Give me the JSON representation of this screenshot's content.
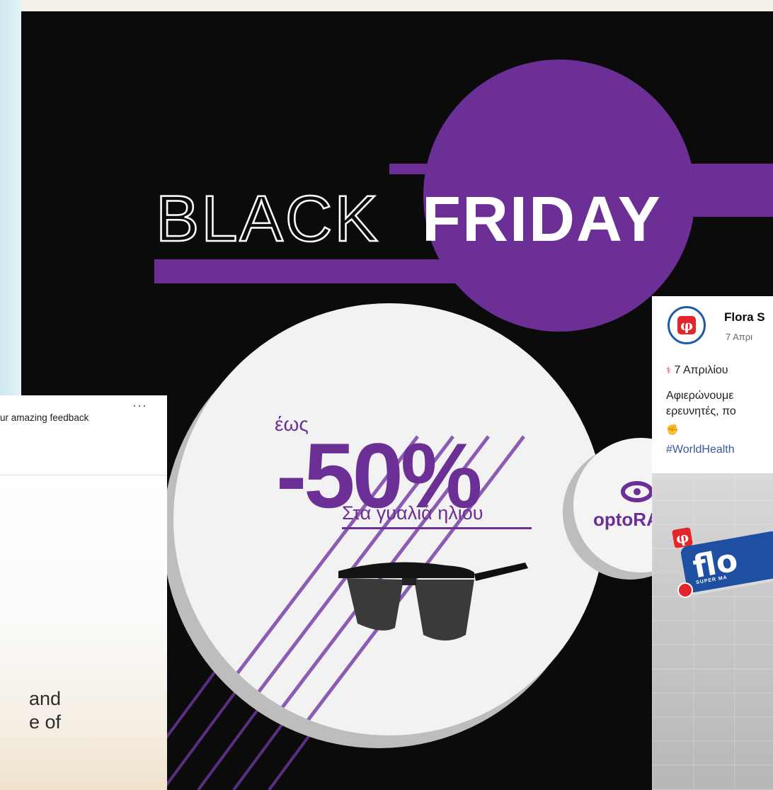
{
  "promo": {
    "title_outline": "BLACK",
    "title_solid": "FRIDAY",
    "prefix": "έως",
    "discount": "-50%",
    "subtitle": "Στα γυαλιά ηλίου",
    "brand": "optoRAMA",
    "colors": {
      "purple": "#6b2f96",
      "background": "#0b0b0b",
      "disc": "#f2f2f2"
    }
  },
  "left_post": {
    "menu": "···",
    "snippet": "ur amazing feedback",
    "quote": "and\ne of"
  },
  "right_post": {
    "page_name": "Flora S",
    "date": "7 Απρι",
    "line1": "7 Απριλίου",
    "line2": "Αφιερώνουμε",
    "line3": "ερευνητές, πο",
    "hashtag": "#WorldHealth",
    "store_sign": "flo",
    "store_sub": "SUPER MA",
    "logo_glyph": "φ"
  }
}
